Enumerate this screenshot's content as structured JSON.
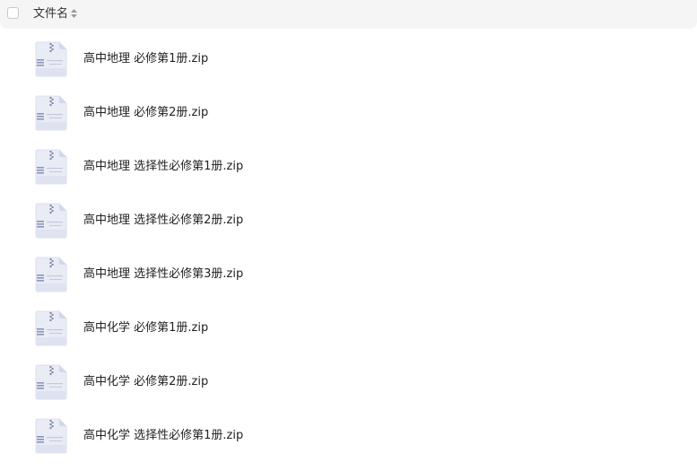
{
  "header": {
    "column_label": "文件名",
    "sort_icon": "sort-updown-icon"
  },
  "files": [
    {
      "name": "高中地理 必修第1册.zip",
      "icon": "zip-file-icon"
    },
    {
      "name": "高中地理 必修第2册.zip",
      "icon": "zip-file-icon"
    },
    {
      "name": "高中地理 选择性必修第1册.zip",
      "icon": "zip-file-icon"
    },
    {
      "name": "高中地理 选择性必修第2册.zip",
      "icon": "zip-file-icon"
    },
    {
      "name": "高中地理 选择性必修第3册.zip",
      "icon": "zip-file-icon"
    },
    {
      "name": "高中化学 必修第1册.zip",
      "icon": "zip-file-icon"
    },
    {
      "name": "高中化学 必修第2册.zip",
      "icon": "zip-file-icon"
    },
    {
      "name": "高中化学 选择性必修第1册.zip",
      "icon": "zip-file-icon"
    }
  ]
}
